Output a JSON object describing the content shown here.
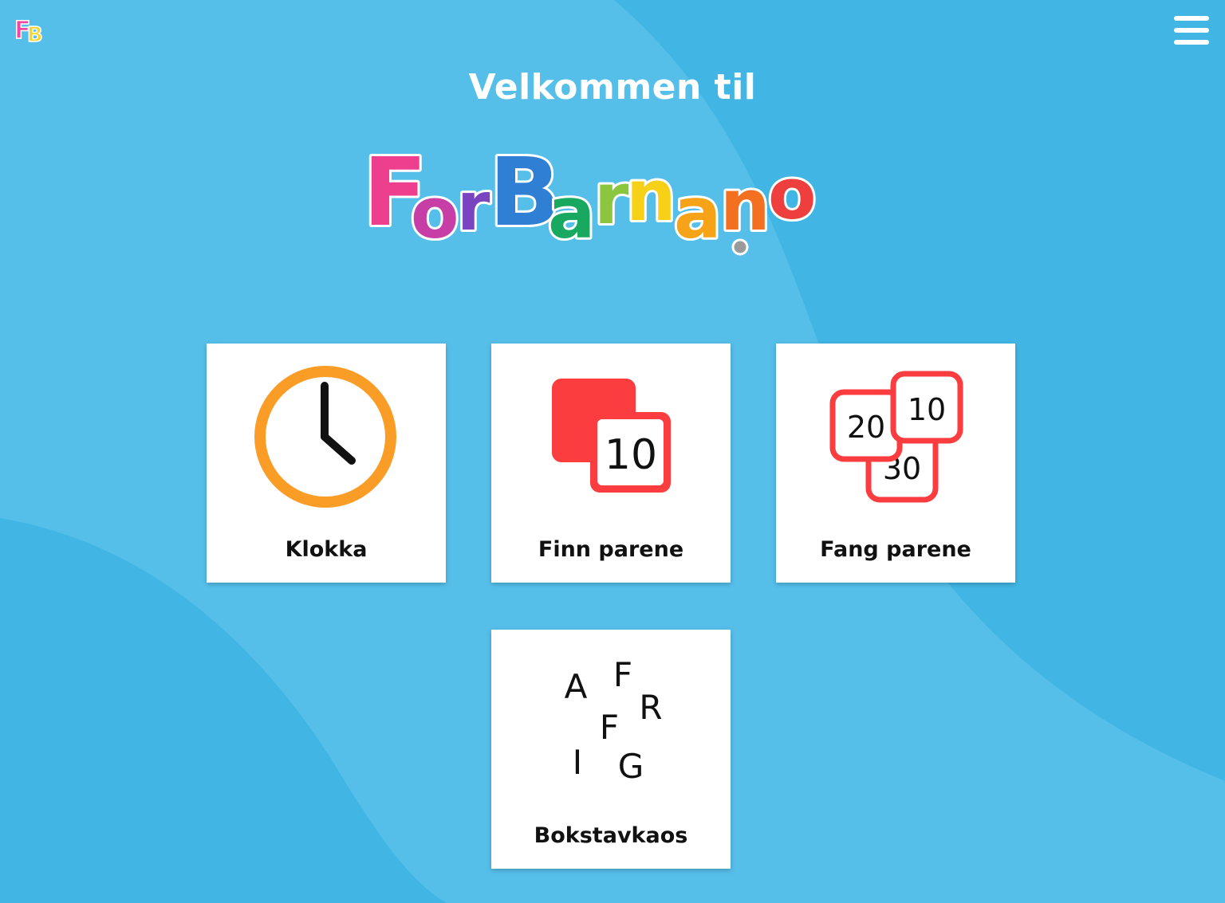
{
  "header": {
    "app_icon": "forbarna-fb-icon",
    "menu_icon": "hamburger-menu-icon",
    "welcome_title": "Velkommen til",
    "brand_logo_text": "ForBarna.no"
  },
  "games": [
    {
      "label": "Klokka",
      "icon": "clock-icon"
    },
    {
      "label": "Finn parene",
      "icon": "memory-cards-icon",
      "card_number": "10"
    },
    {
      "label": "Fang parene",
      "icon": "number-cards-icon",
      "card_numbers": [
        "20",
        "10",
        "30"
      ]
    },
    {
      "label": "Bokstavkaos",
      "icon": "scattered-letters-icon",
      "letters": [
        "A",
        "F",
        "R",
        "F",
        "I",
        "G"
      ]
    }
  ],
  "colors": {
    "background": "#55bfea",
    "background_wave": "#41b6e4",
    "clock_ring": "#f99d27",
    "card_red": "#fc3d40"
  }
}
